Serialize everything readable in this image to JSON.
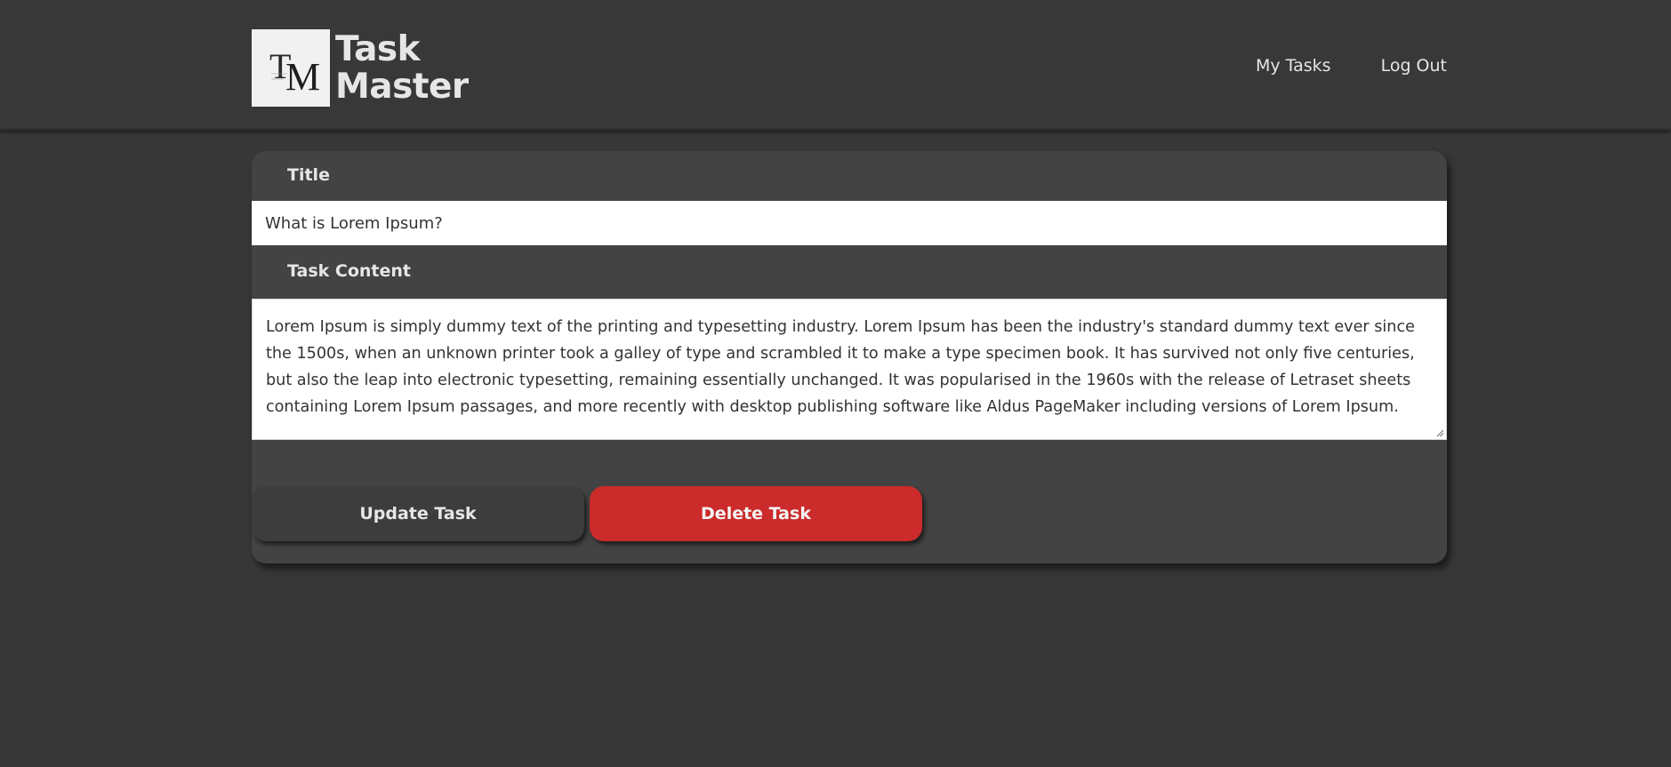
{
  "header": {
    "brand_line1": "Task",
    "brand_line2": "Master",
    "nav": {
      "my_tasks": "My Tasks",
      "log_out": "Log Out"
    }
  },
  "form": {
    "title_label": "Title",
    "title_value": "What is Lorem Ipsum?",
    "content_label": "Task Content",
    "content_value": "Lorem Ipsum is simply dummy text of the printing and typesetting industry. Lorem Ipsum has been the industry's standard dummy text ever since the 1500s, when an unknown printer took a galley of type and scrambled it to make a type specimen book. It has survived not only five centuries, but also the leap into electronic typesetting, remaining essentially unchanged. It was popularised in the 1960s with the release of Letraset sheets containing Lorem Ipsum passages, and more recently with desktop publishing software like Aldus PageMaker including versions of Lorem Ipsum.",
    "update_label": "Update Task",
    "delete_label": "Delete Task"
  },
  "colors": {
    "background": "#373737",
    "card": "#434343",
    "delete_button": "#cc2b2b",
    "text_light": "#e6e6e6"
  },
  "icons": {
    "logo": "tm-monogram-logo",
    "resize": "resize-grip-icon"
  }
}
